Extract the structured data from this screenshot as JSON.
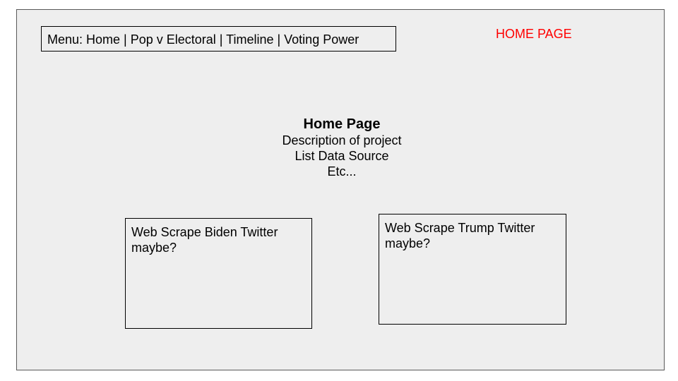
{
  "menu": {
    "text": "Menu: Home | Pop v Electoral | Timeline | Voting Power"
  },
  "page_tag": {
    "text": "HOME PAGE",
    "color": "#ff0000"
  },
  "center": {
    "title": "Home Page",
    "lines": [
      "Description of project",
      "List Data Source",
      "Etc..."
    ]
  },
  "cards": [
    {
      "text": "Web Scrape Biden Twitter maybe?"
    },
    {
      "text": "Web Scrape Trump Twitter maybe?"
    }
  ]
}
